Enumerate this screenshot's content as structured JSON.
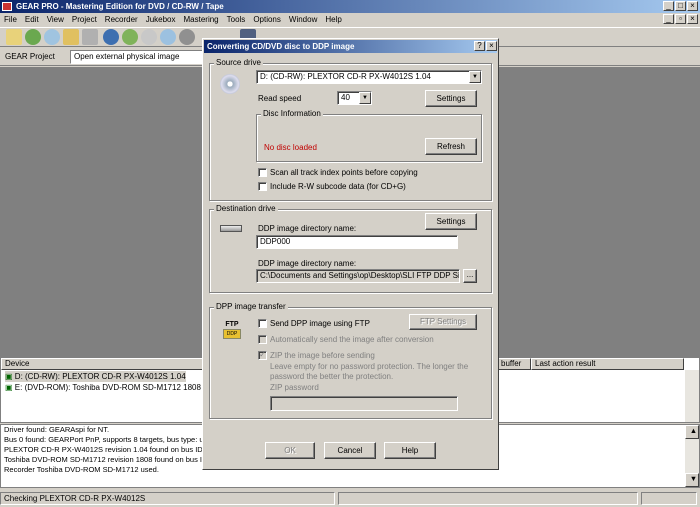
{
  "window": {
    "title": "GEAR PRO - Mastering Edition for DVD / CD-RW / Tape"
  },
  "menu": [
    "File",
    "Edit",
    "View",
    "Project",
    "Recorder",
    "Jukebox",
    "Mastering",
    "Tools",
    "Options",
    "Window",
    "Help"
  ],
  "project_bar": {
    "label": "GEAR Project",
    "value": "Open external physical image"
  },
  "device_list": {
    "headers": [
      "Device",
      "buffer",
      "Last action result"
    ],
    "rows": [
      "D: (CD-RW):  PLEXTOR CD-R   PX-W4012S 1.04",
      "E: (DVD-ROM):  Toshiba DVD-ROM SD-M1712 1808"
    ]
  },
  "log": [
    "Driver found: GEARAspi for NT.",
    "Bus 0 found: GEARPort PnP, supports 8 targets, bus type: un",
    "PLEXTOR  CD-R   PX-W4012S revision 1.04 found on bus ID",
    "Toshiba  DVD-ROM SD-M1712 revision 1808 found on bus ID",
    "Recorder Toshiba DVD-ROM SD-M1712 used."
  ],
  "status": {
    "text": "Checking PLEXTOR CD-R   PX-W4012S"
  },
  "dialog": {
    "title": "Converting CD/DVD disc to DDP image",
    "help_btn": "?",
    "close_btn": "×",
    "source": {
      "group": "Source drive",
      "drive": "D: (CD-RW):  PLEXTOR CD-R   PX-W4012S 1.04",
      "read_speed_label": "Read speed",
      "read_speed": "40",
      "settings": "Settings",
      "disc_info_group": "Disc Information",
      "disc_status": "No disc loaded",
      "refresh": "Refresh",
      "scan_label": "Scan all track index points before copying",
      "rw_label": "Include R-W subcode data (for CD+G)"
    },
    "destination": {
      "group": "Destination drive",
      "settings": "Settings",
      "dir_name_label": "DDP image directory name:",
      "dir_name": "DDP000",
      "dir_path_label": "DDP image directory name:",
      "dir_path": "C:\\Documents and Settings\\op\\Desktop\\SLI FTP DDP Site",
      "browse": "..."
    },
    "transfer": {
      "group": "DPP image transfer",
      "ftp_icon_text": "FTP",
      "ftp_icon_sub": "DDP",
      "send_ftp": "Send DPP image using FTP",
      "ftp_settings": "FTP Settings",
      "auto_send": "Automatically send the image after conversion",
      "zip": "ZIP the image before sending",
      "zip_note": "Leave empty for no password protection. The longer the password the better the protection.",
      "zip_password_label": "ZIP password"
    },
    "buttons": {
      "ok": "OK",
      "cancel": "Cancel",
      "help": "Help"
    }
  },
  "colors": {
    "title_gradient_start": "#0a246a",
    "title_gradient_end": "#a6caf0",
    "error_text": "#c00000",
    "workspace": "#808080"
  }
}
